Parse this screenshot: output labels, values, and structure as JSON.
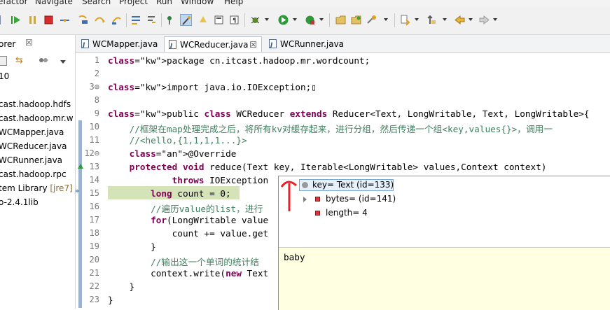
{
  "menu": [
    "efactor",
    "Navigate",
    "Search",
    "Project",
    "Run",
    "Window",
    "Help"
  ],
  "explorer": {
    "tab_label": "orer",
    "count_label": "10",
    "items": [
      {
        "label": "cast.hadoop.hdfs",
        "suffix": ""
      },
      {
        "label": "cast.hadoop.mr.w",
        "suffix": ""
      },
      {
        "label": "WCMapper.java",
        "suffix": ""
      },
      {
        "label": "WCReducer.java",
        "suffix": ""
      },
      {
        "label": "WCRunner.java",
        "suffix": ""
      },
      {
        "label": "cast.hadoop.rpc",
        "suffix": ""
      },
      {
        "label": "tem Library ",
        "suffix": "[jre7]"
      },
      {
        "label": "o-2.4.1lib",
        "suffix": ""
      }
    ]
  },
  "editor_tabs": [
    {
      "label": "WCMapper.java",
      "active": false
    },
    {
      "label": "WCReducer.java",
      "active": true,
      "close": "☒"
    },
    {
      "label": "WCRunner.java",
      "active": false
    }
  ],
  "code_lines": [
    {
      "num": "1",
      "text": "package cn.itcast.hadoop.mr.wordcount;"
    },
    {
      "num": "2",
      "text": ""
    },
    {
      "num": "3⊕",
      "text": "import java.io.IOException;▯"
    },
    {
      "num": "8",
      "text": ""
    },
    {
      "num": "9",
      "text": "public class WCReducer extends Reducer<Text, LongWritable, Text, LongWritable>{"
    },
    {
      "num": "10",
      "text": "    //框架在map处理完成之后，将所有kv对缓存起来，进行分组，然后传递一个组<key,values{}>，调用一"
    },
    {
      "num": "11",
      "text": "    //<hello,{1,1,1,1...}>"
    },
    {
      "num": "12⊖",
      "text": "    @Override"
    },
    {
      "num": "13",
      "text": "    protected void reduce(Text key, Iterable<LongWritable> values,Context context)"
    },
    {
      "num": "14",
      "text": "            throws IOException"
    },
    {
      "num": "15",
      "text": "        long count = 0;"
    },
    {
      "num": "16",
      "text": "        //遍历value的list，进行"
    },
    {
      "num": "17",
      "text": "        for(LongWritable value"
    },
    {
      "num": "18",
      "text": "            count += value.get"
    },
    {
      "num": "19",
      "text": "        }"
    },
    {
      "num": "20",
      "text": "        //输出这一个单词的统计结"
    },
    {
      "num": "21",
      "text": "        context.write(new Text"
    },
    {
      "num": "22",
      "text": "    }"
    },
    {
      "num": "23",
      "text": "}"
    }
  ],
  "inspector": {
    "root": "key= Text  (id=133)",
    "children": [
      "bytes= (id=141)",
      "length= 4"
    ],
    "detail": "baby"
  },
  "colors": {
    "keyword": "#7f0055",
    "comment": "#3f7f5f",
    "current_line": "#d4e3b8",
    "detail_bg": "#ffffe1"
  }
}
